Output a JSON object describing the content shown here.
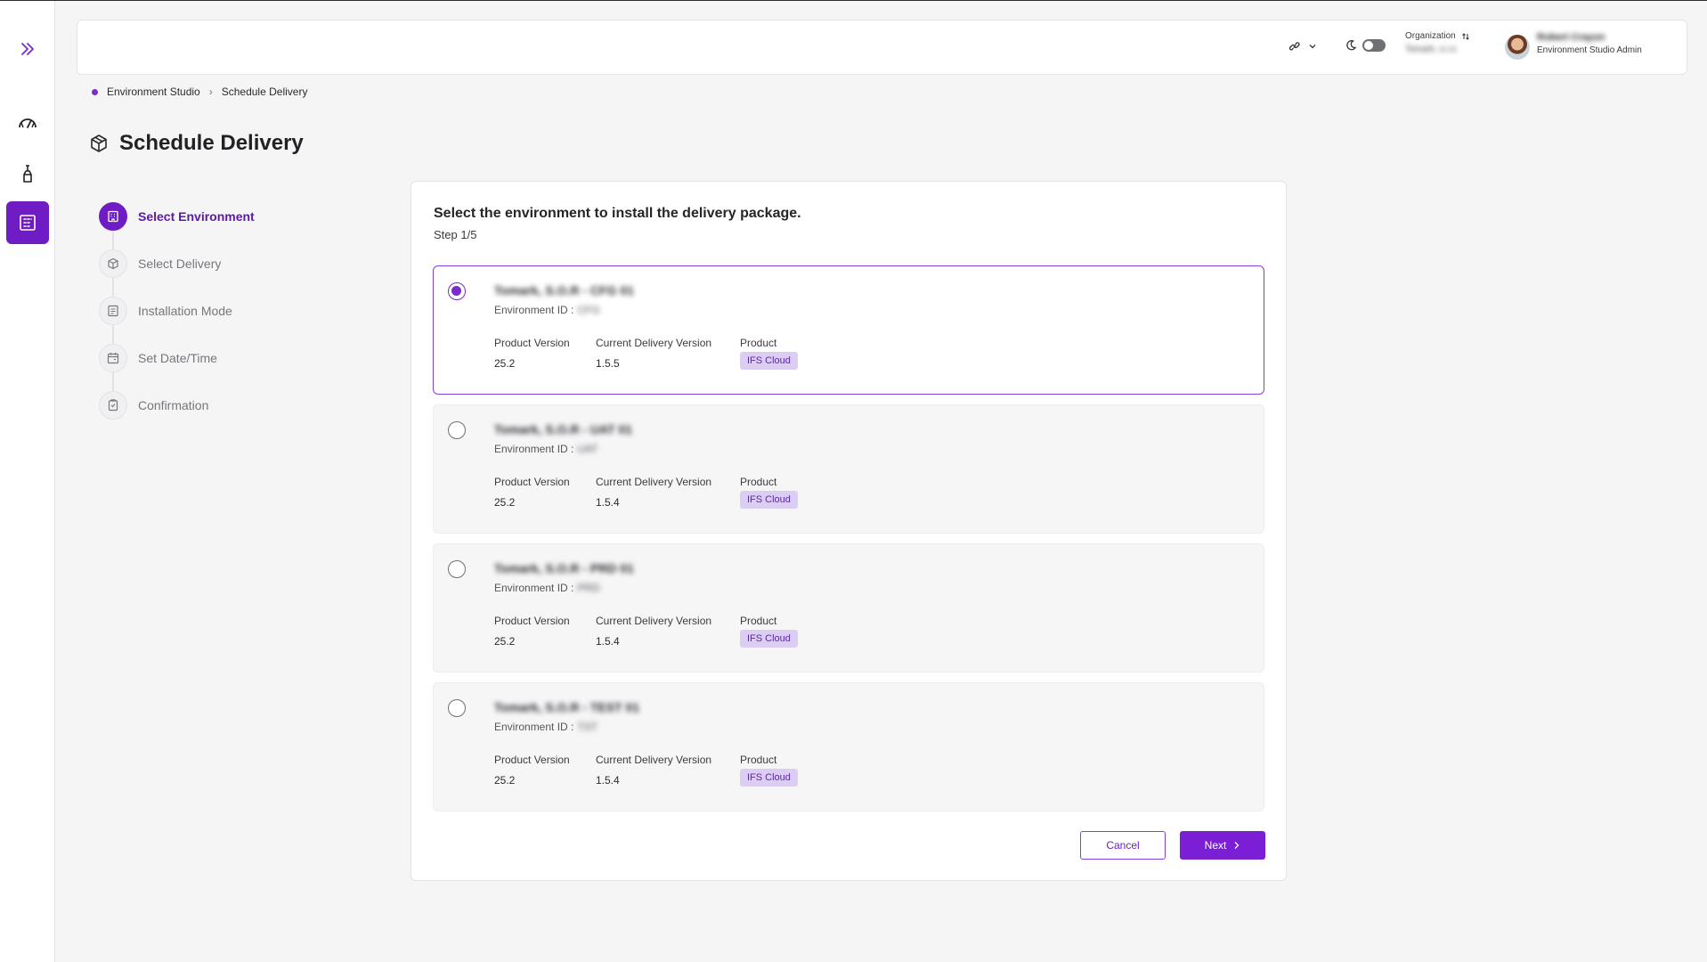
{
  "colors": {
    "accent": "#7a1fd6",
    "accent_dark": "#5e16ad",
    "badge_bg": "#dccdf3"
  },
  "rail": {
    "items": [
      {
        "icon": "expand-icon"
      },
      {
        "icon": "dashboard-gauge-icon"
      },
      {
        "icon": "flask-icon"
      },
      {
        "icon": "building-icon",
        "active": true
      }
    ]
  },
  "header": {
    "link_icon": "link-icon",
    "theme_icon": "moon-icon",
    "organization_label": "Organization",
    "organization_name": "Tomark, s.r.o",
    "user_name": "Robert Crayon",
    "user_role": "Environment Studio Admin"
  },
  "breadcrumb": {
    "root": "Environment Studio",
    "current": "Schedule Delivery"
  },
  "page": {
    "title": "Schedule Delivery"
  },
  "steps": [
    {
      "label": "Select Environment",
      "active": true
    },
    {
      "label": "Select Delivery"
    },
    {
      "label": "Installation Mode"
    },
    {
      "label": "Set Date/Time"
    },
    {
      "label": "Confirmation"
    }
  ],
  "card": {
    "heading": "Select the environment to install the delivery package.",
    "step": "Step 1/5"
  },
  "labels": {
    "environment_id": "Environment ID :",
    "product_version": "Product Version",
    "current_delivery_version": "Current Delivery Version",
    "product": "Product"
  },
  "environments": [
    {
      "name": "Tomark, S.O.R - CFG 01",
      "id": "CFG",
      "product_version": "25.2",
      "delivery_version": "1.5.5",
      "product": "IFS Cloud",
      "selected": true
    },
    {
      "name": "Tomark, S.O.R - UAT 01",
      "id": "UAT",
      "product_version": "25.2",
      "delivery_version": "1.5.4",
      "product": "IFS Cloud"
    },
    {
      "name": "Tomark, S.O.R - PRD 01",
      "id": "PRD",
      "product_version": "25.2",
      "delivery_version": "1.5.4",
      "product": "IFS Cloud"
    },
    {
      "name": "Tomark, S.O.R - TEST 01",
      "id": "TST",
      "product_version": "25.2",
      "delivery_version": "1.5.4",
      "product": "IFS Cloud"
    }
  ],
  "buttons": {
    "cancel": "Cancel",
    "next": "Next"
  }
}
